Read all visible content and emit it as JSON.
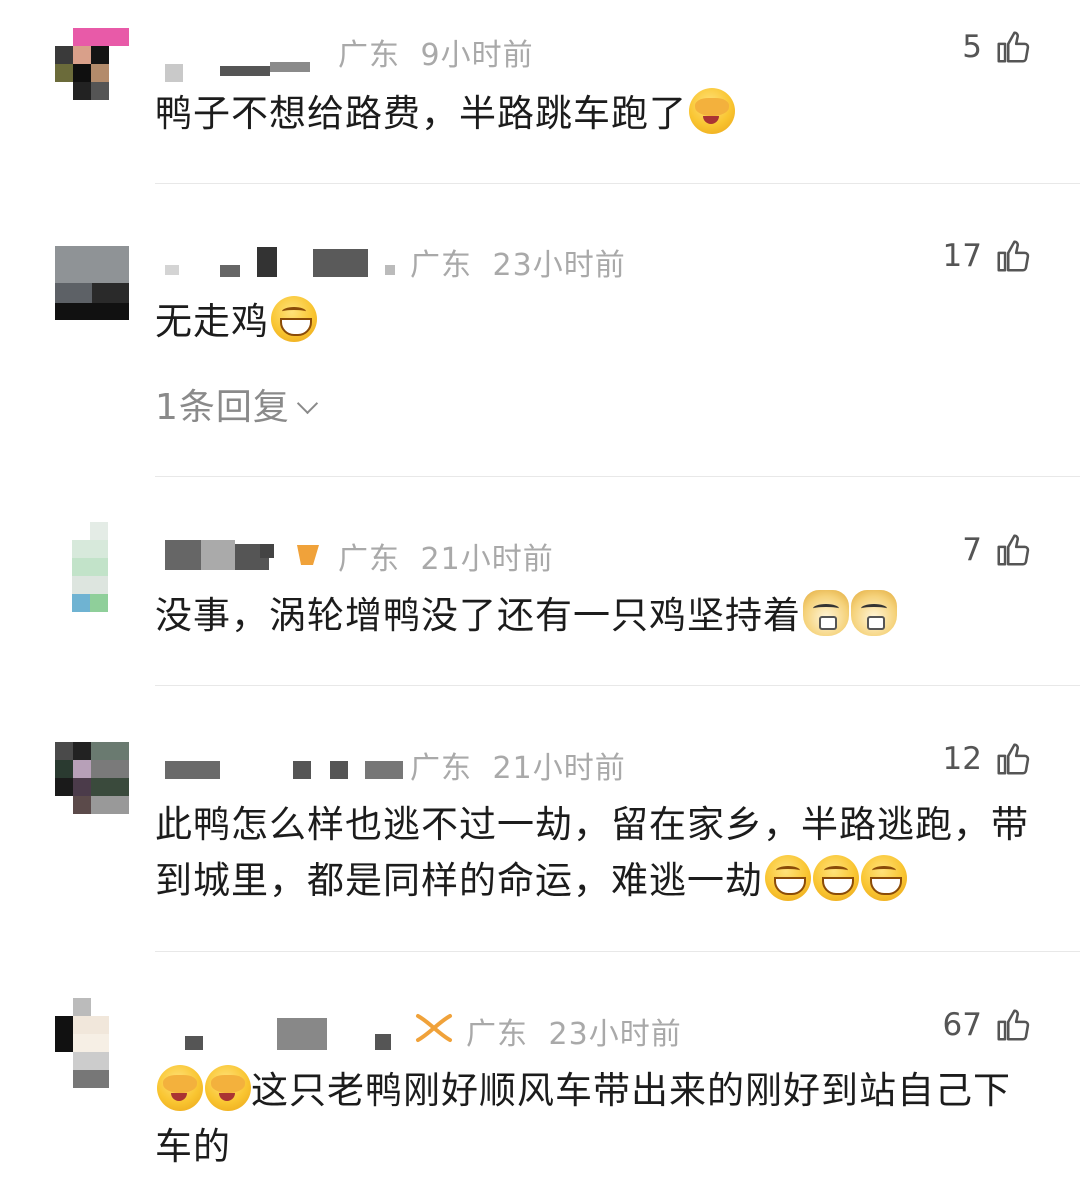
{
  "comments": [
    {
      "location": "广东",
      "time": "9小时前",
      "likes": "5",
      "text": "鸭子不想给路费，半路跳车跑了",
      "emoji": [
        "cover"
      ]
    },
    {
      "location": "广东",
      "time": "23小时前",
      "likes": "17",
      "text": "无走鸡",
      "emoji": [
        "grin"
      ],
      "reply": "1条回复"
    },
    {
      "location": "广东",
      "time": "21小时前",
      "likes": "7",
      "text": "没事，涡轮增鸭没了还有一只鸡坚持着",
      "emoji": [
        "cat",
        "cat"
      ]
    },
    {
      "location": "广东",
      "time": "21小时前",
      "likes": "12",
      "text": "此鸭怎么样也逃不过一劫，留在家乡，半路逃跑，带到城里，都是同样的命运，难逃一劫",
      "emoji": [
        "grin",
        "grin",
        "grin"
      ]
    },
    {
      "location": "广东",
      "time": "23小时前",
      "likes": "67",
      "text": "这只老鸭刚好顺风车带出来的刚好到站自己下车的",
      "emoji": [
        "cover",
        "cover"
      ]
    }
  ],
  "icons": {
    "like": "thumbs-up-icon",
    "chevron": "chevron-down-icon",
    "emoji_cover": "facepalm-emoji",
    "emoji_grin": "grin-emoji",
    "emoji_cat": "doge-emoji"
  },
  "colors": {
    "meta": "#a9a9a9",
    "text": "#1c1c1c",
    "divider": "#e8e8e8",
    "badge": "#f0a23a"
  }
}
